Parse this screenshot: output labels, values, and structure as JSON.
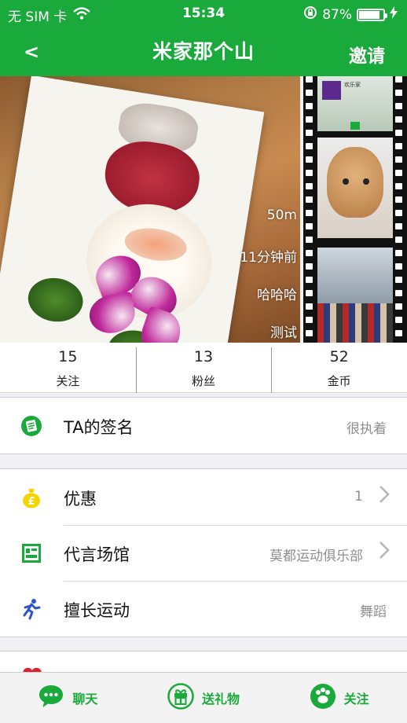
{
  "status_bar": {
    "carrier": "无 SIM 卡",
    "time": "15:34",
    "battery_percent": "87%",
    "battery_level": 0.87
  },
  "nav": {
    "back_label": "<",
    "title": "米家那个山",
    "invite_label": "邀请"
  },
  "photo_overlay": [
    "50m",
    "11分钟前",
    "哈哈哈",
    "测试"
  ],
  "mini_screen_text": "欢乐家",
  "stats": [
    {
      "value": "15",
      "label": "关注"
    },
    {
      "value": "13",
      "label": "粉丝"
    },
    {
      "value": "52",
      "label": "金币"
    }
  ],
  "signature": {
    "label": "TA的签名",
    "value": "很执着"
  },
  "details": [
    {
      "label": "优惠",
      "value": "1",
      "chevron": true,
      "icon": "money-bag-icon"
    },
    {
      "label": "代言场馆",
      "value": "莫都运动俱乐部",
      "chevron": true,
      "icon": "venue-icon"
    },
    {
      "label": "擅长运动",
      "value": "舞蹈",
      "chevron": false,
      "icon": "runner-icon"
    }
  ],
  "toolbar": {
    "chat_label": "聊天",
    "gift_label": "送礼物",
    "follow_label": "关注"
  },
  "colors": {
    "brand_green": "#1aaa3b",
    "coupon_yellow": "#f6d400",
    "sport_blue": "#2f54c9",
    "heart_red": "#d9242f"
  }
}
